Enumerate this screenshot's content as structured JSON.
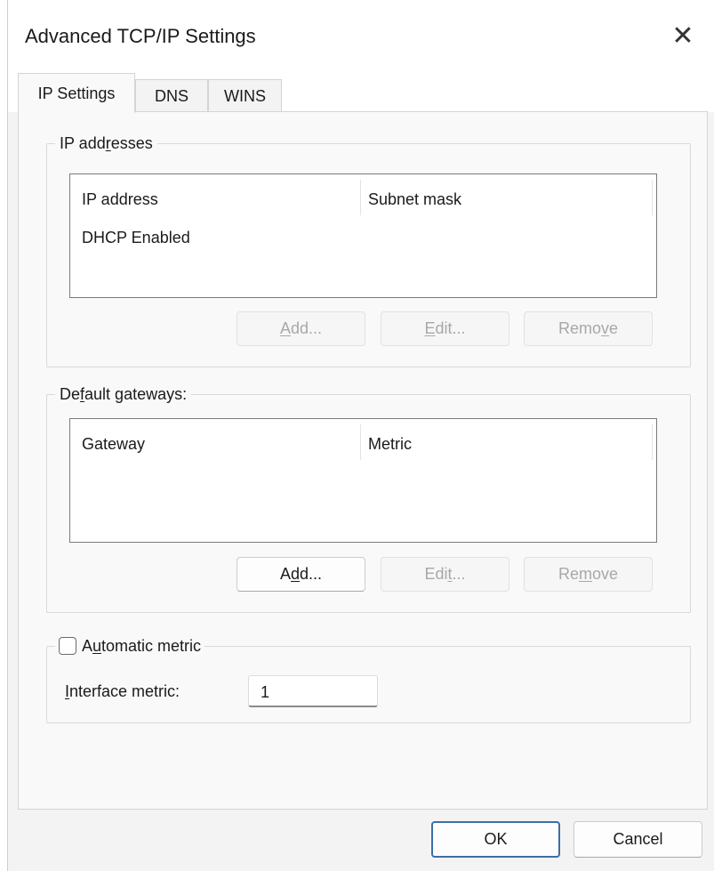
{
  "window": {
    "title": "Advanced TCP/IP Settings",
    "close_glyph": "✕"
  },
  "tabs": [
    {
      "label": "IP Settings",
      "active": true
    },
    {
      "label": "DNS",
      "active": false
    },
    {
      "label": "WINS",
      "active": false
    }
  ],
  "ip_addresses": {
    "legend_pre": "IP add",
    "legend_u": "r",
    "legend_post": "esses",
    "columns": [
      "IP address",
      "Subnet mask"
    ],
    "rows": [
      [
        "DHCP Enabled",
        ""
      ]
    ],
    "add": {
      "pre": "",
      "u": "A",
      "post": "dd..."
    },
    "edit": {
      "pre": "",
      "u": "E",
      "post": "dit..."
    },
    "remove": {
      "pre": "Remo",
      "u": "v",
      "post": "e"
    }
  },
  "default_gateways": {
    "legend_pre": "De",
    "legend_u": "f",
    "legend_post": "ault gateways:",
    "columns": [
      "Gateway",
      "Metric"
    ],
    "rows": [],
    "add": {
      "pre": "A",
      "u": "d",
      "post": "d..."
    },
    "edit": {
      "pre": "Edi",
      "u": "t",
      "post": "..."
    },
    "remove": {
      "pre": "Re",
      "u": "m",
      "post": "ove"
    }
  },
  "metric": {
    "auto_checked": false,
    "auto_pre": "A",
    "auto_u": "u",
    "auto_post": "tomatic metric",
    "iface_pre": "",
    "iface_u": "I",
    "iface_post": "nterface metric:",
    "iface_value": "1"
  },
  "footer": {
    "ok": "OK",
    "cancel": "Cancel"
  }
}
